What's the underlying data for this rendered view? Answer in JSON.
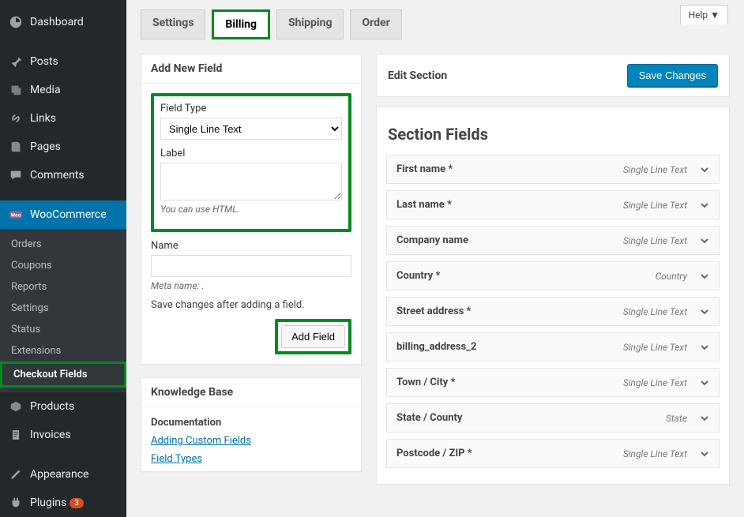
{
  "sidebar": {
    "items": [
      {
        "label": "Dashboard",
        "icon": "dashboard"
      },
      {
        "label": "Posts",
        "icon": "pin"
      },
      {
        "label": "Media",
        "icon": "media"
      },
      {
        "label": "Links",
        "icon": "link"
      },
      {
        "label": "Pages",
        "icon": "pages"
      },
      {
        "label": "Comments",
        "icon": "comment"
      },
      {
        "label": "WooCommerce",
        "icon": "woo",
        "active": true,
        "submenu": [
          {
            "label": "Orders"
          },
          {
            "label": "Coupons"
          },
          {
            "label": "Reports"
          },
          {
            "label": "Settings"
          },
          {
            "label": "Status"
          },
          {
            "label": "Extensions"
          },
          {
            "label": "Checkout Fields",
            "current": true,
            "highlight": true
          }
        ]
      },
      {
        "label": "Products",
        "icon": "products"
      },
      {
        "label": "Invoices",
        "icon": "invoices"
      },
      {
        "label": "Appearance",
        "icon": "appearance"
      },
      {
        "label": "Plugins",
        "icon": "plugins",
        "badge": "3"
      }
    ]
  },
  "help_label": "Help ▼",
  "tabs": [
    {
      "label": "Settings"
    },
    {
      "label": "Billing",
      "active": true,
      "highlight": true
    },
    {
      "label": "Shipping"
    },
    {
      "label": "Order"
    }
  ],
  "add_field": {
    "title": "Add New Field",
    "field_type_label": "Field Type",
    "field_type_value": "Single Line Text",
    "label_label": "Label",
    "label_value": "",
    "label_hint": "You can use HTML.",
    "name_label": "Name",
    "name_value": "",
    "meta_name": "Meta name: .",
    "note": "Save changes after adding a field.",
    "button_label": "Add Field"
  },
  "kb": {
    "title": "Knowledge Base",
    "section": "Documentation",
    "links": [
      "Adding Custom Fields",
      "Field Types"
    ]
  },
  "edit_section": {
    "title": "Edit Section",
    "save_label": "Save Changes",
    "fields_heading": "Section Fields",
    "fields": [
      {
        "name": "First name *",
        "type": "Single Line Text"
      },
      {
        "name": "Last name *",
        "type": "Single Line Text"
      },
      {
        "name": "Company name",
        "type": "Single Line Text"
      },
      {
        "name": "Country *",
        "type": "Country"
      },
      {
        "name": "Street address *",
        "type": "Single Line Text"
      },
      {
        "name": "billing_address_2",
        "type": "Single Line Text"
      },
      {
        "name": "Town / City *",
        "type": "Single Line Text"
      },
      {
        "name": "State / County",
        "type": "State"
      },
      {
        "name": "Postcode / ZIP *",
        "type": "Single Line Text"
      }
    ]
  }
}
